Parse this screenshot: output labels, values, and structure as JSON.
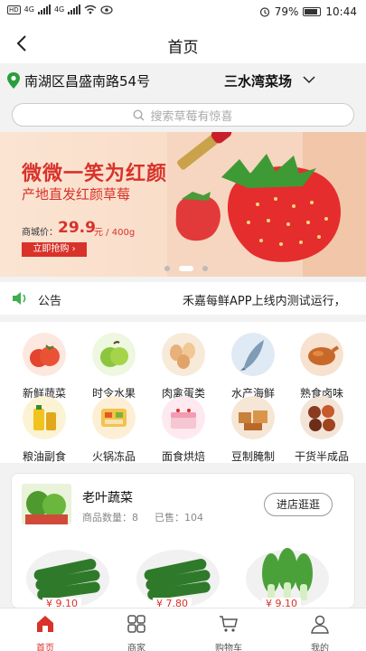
{
  "status": {
    "carrier1": "4G",
    "carrier2": "4G",
    "battery": "79%",
    "time": "10:44"
  },
  "nav": {
    "title": "首页"
  },
  "location": {
    "address": "南湖区昌盛南路54号",
    "store": "三水湾菜场"
  },
  "search": {
    "placeholder": "搜索草莓有惊喜"
  },
  "banner": {
    "headline": "微微一笑为红颜",
    "subtitle": "产地直发红颜草莓",
    "price_label": "商城价：",
    "price": "29.9",
    "unit": "元 / 400g",
    "buy_label": "立即抢购 ›",
    "slide_index": 1,
    "slide_count": 3
  },
  "notice": {
    "label": "公告",
    "text": "禾嘉每鲜APP上线内测试运行，"
  },
  "categories": [
    {
      "label": "新鲜蔬菜",
      "icon": "tomato-icon"
    },
    {
      "label": "时令水果",
      "icon": "apple-icon"
    },
    {
      "label": "肉禽蛋类",
      "icon": "eggs-icon"
    },
    {
      "label": "水产海鲜",
      "icon": "fish-icon"
    },
    {
      "label": "熟食卤味",
      "icon": "roast-chicken-icon"
    },
    {
      "label": "粮油副食",
      "icon": "oil-icon"
    },
    {
      "label": "火锅冻品",
      "icon": "hotpot-icon"
    },
    {
      "label": "面食烘焙",
      "icon": "cake-icon"
    },
    {
      "label": "豆制腌制",
      "icon": "tofu-icon"
    },
    {
      "label": "干货半成品",
      "icon": "dried-goods-icon"
    }
  ],
  "shop": {
    "name": "老叶蔬菜",
    "goods_count": "商品数量：8",
    "sold": "已售：104",
    "visit_label": "进店逛逛",
    "products": [
      {
        "price": "¥ 9.10"
      },
      {
        "price": "¥ 7.80"
      },
      {
        "price": "¥ 9.10"
      }
    ]
  },
  "tabs": [
    {
      "label": "首页",
      "active": true
    },
    {
      "label": "商家",
      "active": false
    },
    {
      "label": "购物车",
      "active": false
    },
    {
      "label": "我的",
      "active": false
    }
  ],
  "colors": {
    "accent": "#d8322a",
    "location_pin": "#2a9d3c"
  }
}
